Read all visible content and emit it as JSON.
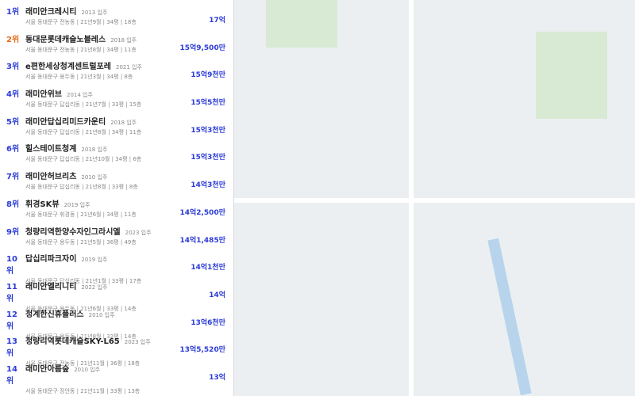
{
  "rows": [
    {
      "rank": "1위",
      "name": "래미안크레시티",
      "year": "2013 입주",
      "sub": "서울 동대문구 전농동 | 21년9월 | 34평 | 18층",
      "price": "17억"
    },
    {
      "rank": "2위",
      "name": "동대문롯데캐슬노블레스",
      "year": "2018 입주",
      "sub": "서울 동대문구 전농동 | 21년8월 | 34평 | 11층",
      "price": "15억9,500만"
    },
    {
      "rank": "3위",
      "name": "e편한세상청계센트럴포레",
      "year": "2021 입주",
      "sub": "서울 동대문구 용두동 | 21년3월 | 34평 | 8층",
      "price": "15억9천만"
    },
    {
      "rank": "4위",
      "name": "래미안위브",
      "year": "2014 입주",
      "sub": "서울 동대문구 답십리동 | 21년7월 | 33평 | 15층",
      "price": "15억5천만"
    },
    {
      "rank": "5위",
      "name": "래미안답십리미드카운티",
      "year": "2018 입주",
      "sub": "서울 동대문구 답십리동 | 21년8월 | 34평 | 11층",
      "price": "15억3천만"
    },
    {
      "rank": "6위",
      "name": "힐스테이트청계",
      "year": "2018 입주",
      "sub": "서울 동대문구 답십리동 | 21년10월 | 34평 | 6층",
      "price": "15억3천만"
    },
    {
      "rank": "7위",
      "name": "래미안허브리츠",
      "year": "2010 입주",
      "sub": "서울 동대문구 답십리동 | 21년8월 | 33평 | 8층",
      "price": "14억3천만"
    },
    {
      "rank": "8위",
      "name": "휘경SK뷰",
      "year": "2019 입주",
      "sub": "서울 동대문구 휘경동 | 21년6월 | 34평 | 11층",
      "price": "14억2,500만"
    },
    {
      "rank": "9위",
      "name": "청량리역한양수자인그라시엘",
      "year": "2023 입주",
      "sub": "서울 동대문구 용두동 | 21년5월 | 36평 | 49층",
      "price": "14억1,485만"
    },
    {
      "rank": "10위",
      "name": "답십리파크자이",
      "year": "2019 입주",
      "sub": "서울 동대문구 답십리동 | 21년1월 | 33평 | 17층",
      "price": "14억1천만"
    },
    {
      "rank": "11위",
      "name": "래미안엘리니티",
      "year": "2022 입주",
      "sub": "서울 동대문구 용두동 | 21년6월 | 33평 | 14층",
      "price": "14억"
    },
    {
      "rank": "12위",
      "name": "청계한신휴플러스",
      "year": "2010 입주",
      "sub": "서울 동대문구 용두동 | 21년8월 | 32평 | 14층",
      "price": "13억6천만"
    },
    {
      "rank": "13위",
      "name": "청량리역롯데캐슬SKY-L65",
      "year": "2023 입주",
      "sub": "서울 동대문구 전농동 | 21년11월 | 36평 | 18층",
      "price": "13억5,520만"
    },
    {
      "rank": "14위",
      "name": "래미안아름숲",
      "year": "2010 입주",
      "sub": "서울 동대문구 장안동 | 21년11월 | 33평 | 13층",
      "price": "13억"
    }
  ]
}
